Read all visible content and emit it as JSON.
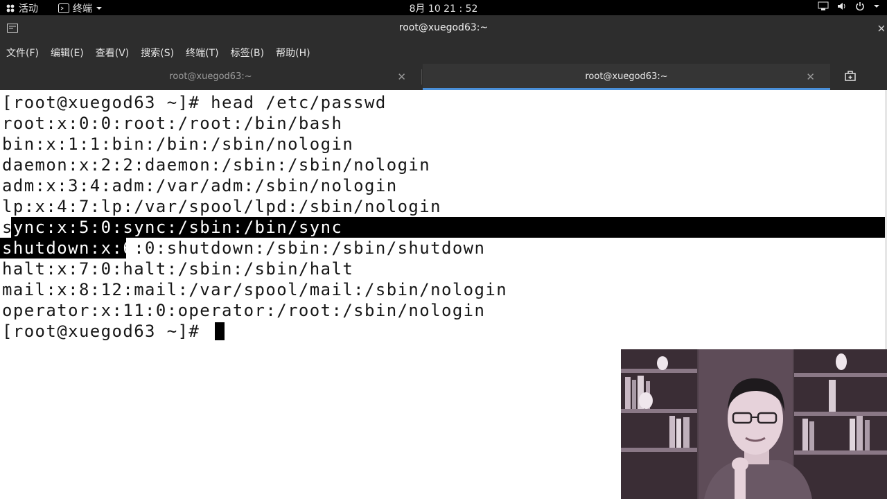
{
  "topbar": {
    "activities": "活动",
    "app_menu": "终端",
    "clock": "8月 10 21 : 52",
    "icons": [
      "network-icon",
      "volume-icon",
      "power-icon",
      "chevron-down-icon"
    ]
  },
  "window": {
    "title": "root@xuegod63:~"
  },
  "menubar": {
    "items": [
      "文件(F)",
      "编辑(E)",
      "查看(V)",
      "搜索(S)",
      "终端(T)",
      "标签(B)",
      "帮助(H)"
    ]
  },
  "tabs": [
    {
      "label": "root@xuegod63:~",
      "active": false
    },
    {
      "label": "root@xuegod63:~",
      "active": true
    }
  ],
  "terminal": {
    "lines": [
      "[root@xuegod63 ~]# head /etc/passwd",
      "root:x:0:0:root:/root:/bin/bash",
      "bin:x:1:1:bin:/bin:/sbin/nologin",
      "daemon:x:2:2:daemon:/sbin:/sbin/nologin",
      "adm:x:3:4:adm:/var/adm:/sbin/nologin",
      "lp:x:4:7:lp:/var/spool/lpd:/sbin/nologin",
      "sync:x:5:0:sync:/sbin:/bin/sync",
      "shutdown:x:6:0:shutdown:/sbin:/sbin/shutdown",
      "halt:x:7:0:halt:/sbin:/sbin/halt",
      "mail:x:8:12:mail:/var/spool/mail:/sbin/nologin",
      "operator:x:11:0:operator:/root:/sbin/nologin",
      "[root@xuegod63 ~]# "
    ],
    "selection_parts": {
      "sync_first": "s",
      "sync_rest": "ync:x:5:0:sync:/sbin:/bin/sync",
      "shutdown_selected": "shutdown:x:6",
      "shutdown_rest": ":0:shutdown:/sbin:/sbin/shutdown"
    }
  },
  "colors": {
    "topbar_bg": "#000000",
    "chrome_bg": "#2d2d2d",
    "terminal_bg": "#ffffff",
    "terminal_fg": "#171717",
    "selection_bg": "#000000",
    "active_tab_accent": "#4a90d9"
  }
}
